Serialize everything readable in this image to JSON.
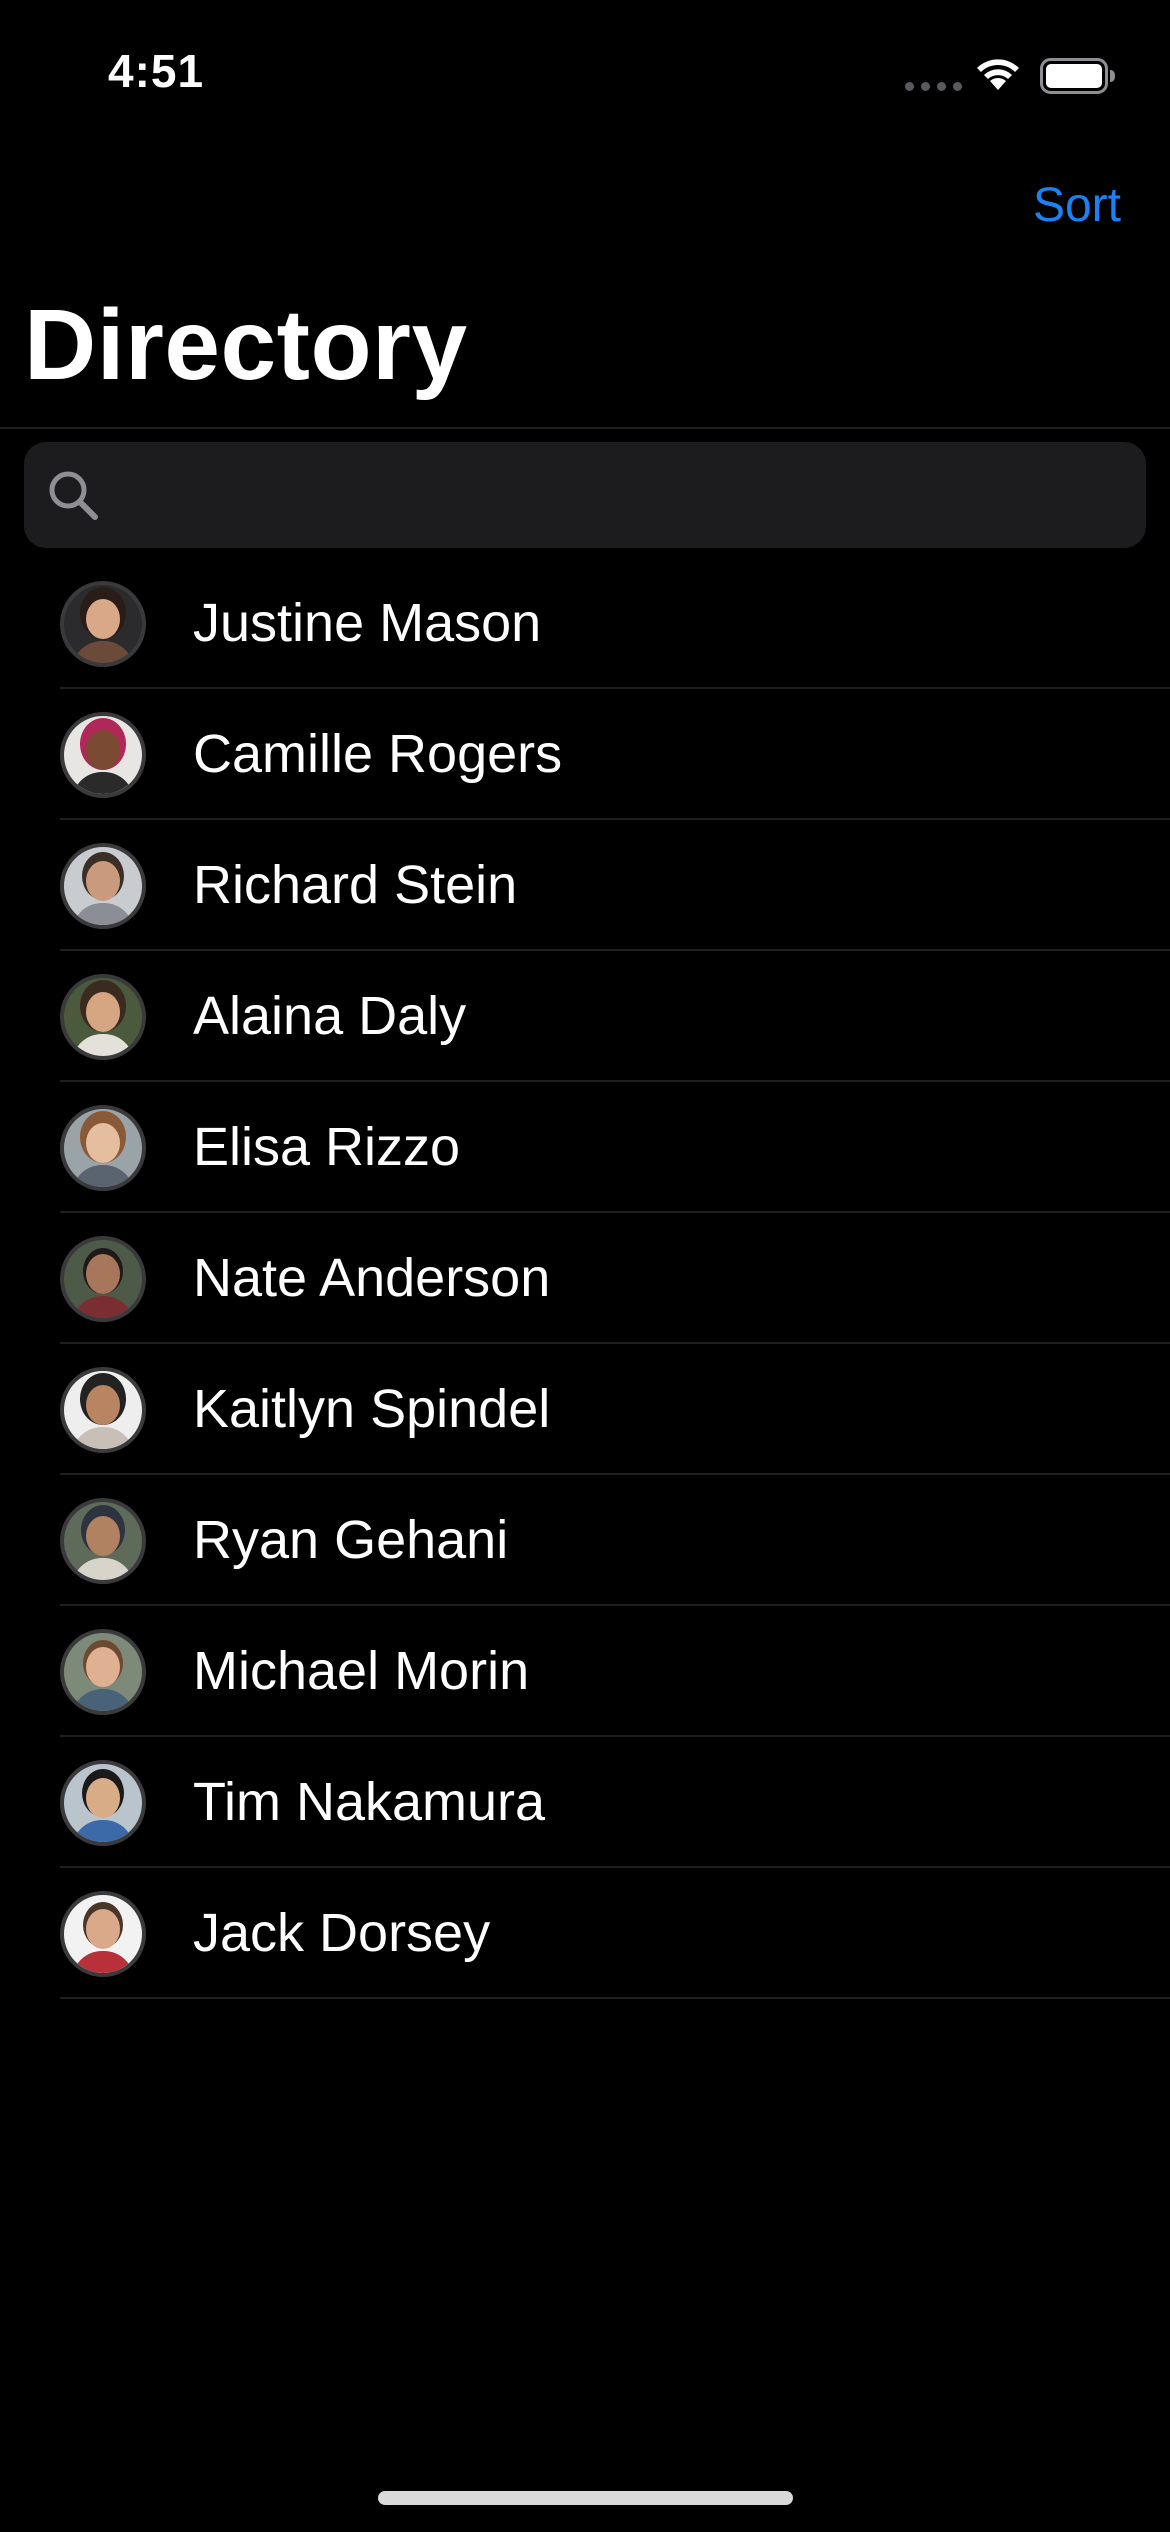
{
  "status_bar": {
    "time": "4:51"
  },
  "nav": {
    "sort_label": "Sort",
    "title": "Directory"
  },
  "search": {
    "placeholder": "",
    "value": ""
  },
  "contacts": [
    {
      "name": "Justine Mason"
    },
    {
      "name": "Camille Rogers"
    },
    {
      "name": "Richard Stein"
    },
    {
      "name": "Alaina Daly"
    },
    {
      "name": "Elisa Rizzo"
    },
    {
      "name": "Nate Anderson"
    },
    {
      "name": "Kaitlyn Spindel"
    },
    {
      "name": "Ryan Gehani"
    },
    {
      "name": "Michael Morin"
    },
    {
      "name": "Tim Nakamura"
    },
    {
      "name": "Jack Dorsey"
    }
  ],
  "colors": {
    "background": "#000000",
    "accent": "#1a82f5",
    "search_field": "#1c1c1e",
    "separator": "#1f1f21"
  }
}
